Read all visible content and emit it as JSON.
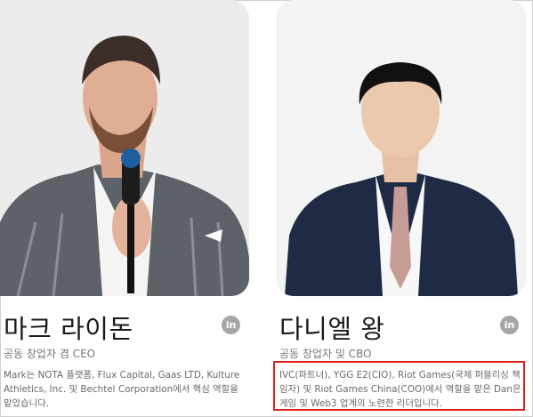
{
  "team": [
    {
      "name": "마크 라이돈",
      "role": "공동 창업자 겸 CEO",
      "bio": "Mark는 NOTA 플랫폼, Flux Capital, Gaas LTD, Kulture Athletics, Inc. 및 Bechtel Corporation에서 핵심 역할을 맡았습니다.",
      "social_icon": "linkedin-icon",
      "social_label": "in"
    },
    {
      "name": "다니엘 왕",
      "role": "공동 창업자 및 CBO",
      "bio": "IVC(파트너), YGG E2(CIO), Riot Games(국제 퍼블리싱 책임자) 및 Riot Games China(COO)에서 역할을 맡은 Dan은 게임 및 Web3 업계의 노련한 리더입니다.",
      "social_icon": "linkedin-icon",
      "social_label": "in"
    }
  ],
  "colors": {
    "highlight_border": "#e0201f",
    "icon_bg": "#a6a6a6"
  }
}
